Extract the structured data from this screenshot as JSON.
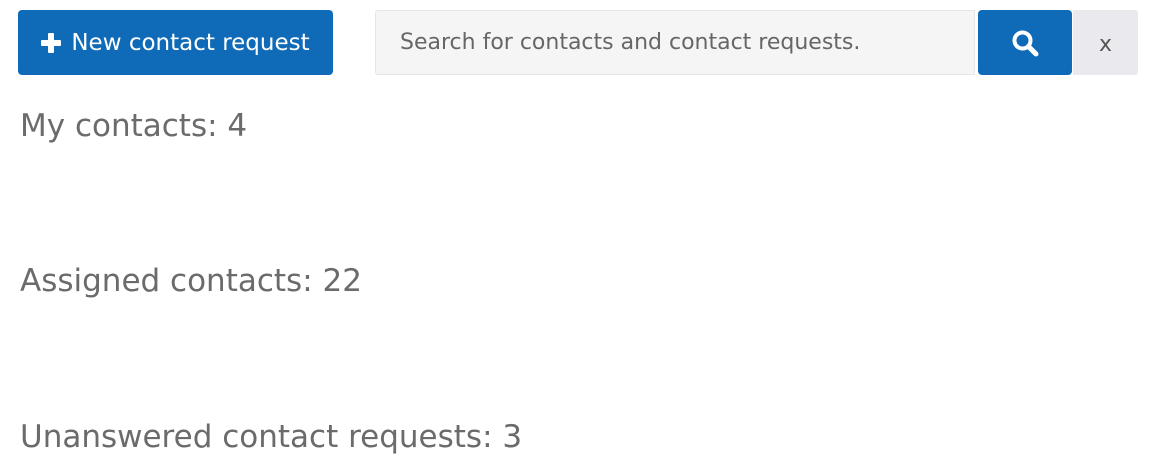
{
  "toolbar": {
    "new_request_label": "New contact request",
    "new_request_icon": "plus-icon",
    "search": {
      "placeholder": "Search for contacts and contact requests.",
      "value": ""
    },
    "search_icon": "search-icon",
    "clear_label": "x"
  },
  "sections": {
    "my_contacts": "My contacts: 4",
    "assigned_contacts": "Assigned contacts: 22",
    "unanswered_requests": "Unanswered contact requests: 3"
  },
  "colors": {
    "primary": "#0f6ab8",
    "heading_text": "#6b6b6b",
    "input_bg": "#f5f5f5",
    "clear_bg": "#e9e9ee"
  }
}
